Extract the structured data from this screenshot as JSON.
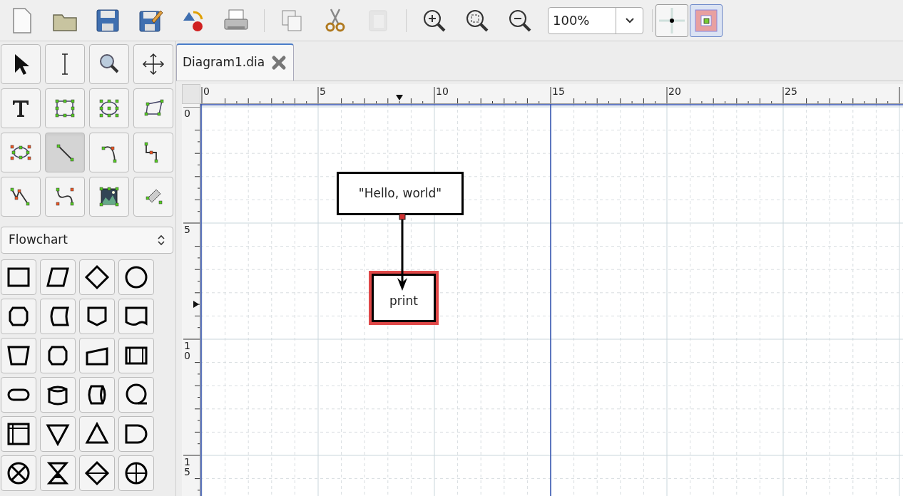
{
  "toolbar": {
    "buttons": [
      {
        "kind": "new",
        "disabled": false
      },
      {
        "kind": "open",
        "disabled": false
      },
      {
        "kind": "save",
        "disabled": false
      },
      {
        "kind": "save-as",
        "disabled": false
      },
      {
        "kind": "export",
        "disabled": false
      },
      {
        "kind": "print",
        "disabled": false
      },
      {
        "kind": "separator"
      },
      {
        "kind": "copy",
        "disabled": false
      },
      {
        "kind": "cut",
        "disabled": false
      },
      {
        "kind": "paste",
        "disabled": true
      },
      {
        "kind": "separator"
      },
      {
        "kind": "zoom-in",
        "disabled": false
      },
      {
        "kind": "zoom-fit",
        "disabled": false
      },
      {
        "kind": "zoom-out",
        "disabled": false
      }
    ],
    "zoom": {
      "value": "100%"
    },
    "toggles": [
      {
        "kind": "snap-grid",
        "on": false
      },
      {
        "kind": "snap-objects",
        "on": true
      }
    ]
  },
  "toolbox": {
    "tools": [
      {
        "kind": "pointer",
        "selected": false
      },
      {
        "kind": "text-edit",
        "selected": false
      },
      {
        "kind": "magnify",
        "selected": false
      },
      {
        "kind": "scroll",
        "selected": false
      },
      {
        "kind": "text",
        "selected": false
      },
      {
        "kind": "box",
        "selected": false
      },
      {
        "kind": "ellipse",
        "selected": false
      },
      {
        "kind": "polygon",
        "selected": false
      },
      {
        "kind": "beziergon",
        "selected": false
      },
      {
        "kind": "line",
        "selected": true
      },
      {
        "kind": "arc",
        "selected": false
      },
      {
        "kind": "zigzag",
        "selected": false
      },
      {
        "kind": "polyline",
        "selected": false
      },
      {
        "kind": "bezier",
        "selected": false
      },
      {
        "kind": "image",
        "selected": false
      },
      {
        "kind": "outline",
        "selected": false
      }
    ],
    "sheet": {
      "value": "Flowchart"
    },
    "shapes": [
      {
        "kind": "box"
      },
      {
        "kind": "parallelogram"
      },
      {
        "kind": "diamond"
      },
      {
        "kind": "circle"
      },
      {
        "kind": "octagon"
      },
      {
        "kind": "stored-data"
      },
      {
        "kind": "offpage"
      },
      {
        "kind": "document"
      },
      {
        "kind": "trapezoid"
      },
      {
        "kind": "octagon"
      },
      {
        "kind": "manual-input"
      },
      {
        "kind": "predefined"
      },
      {
        "kind": "terminal"
      },
      {
        "kind": "cylinder"
      },
      {
        "kind": "drum"
      },
      {
        "kind": "tape"
      },
      {
        "kind": "internal-storage"
      },
      {
        "kind": "merge"
      },
      {
        "kind": "extract"
      },
      {
        "kind": "delay"
      },
      {
        "kind": "summing"
      },
      {
        "kind": "collate"
      },
      {
        "kind": "sort"
      },
      {
        "kind": "or"
      }
    ]
  },
  "tabs": [
    {
      "label": "Diagram1.dia",
      "selected": true
    }
  ],
  "rulers": {
    "horizontal": [
      "0",
      "5",
      "10",
      "15",
      "20",
      "25"
    ],
    "vertical": [
      "0",
      "5",
      "10",
      "15"
    ]
  },
  "diagram": {
    "nodes": [
      {
        "text": "\"Hello, world\"",
        "selected": false
      },
      {
        "text": "print",
        "selected": true
      }
    ]
  }
}
